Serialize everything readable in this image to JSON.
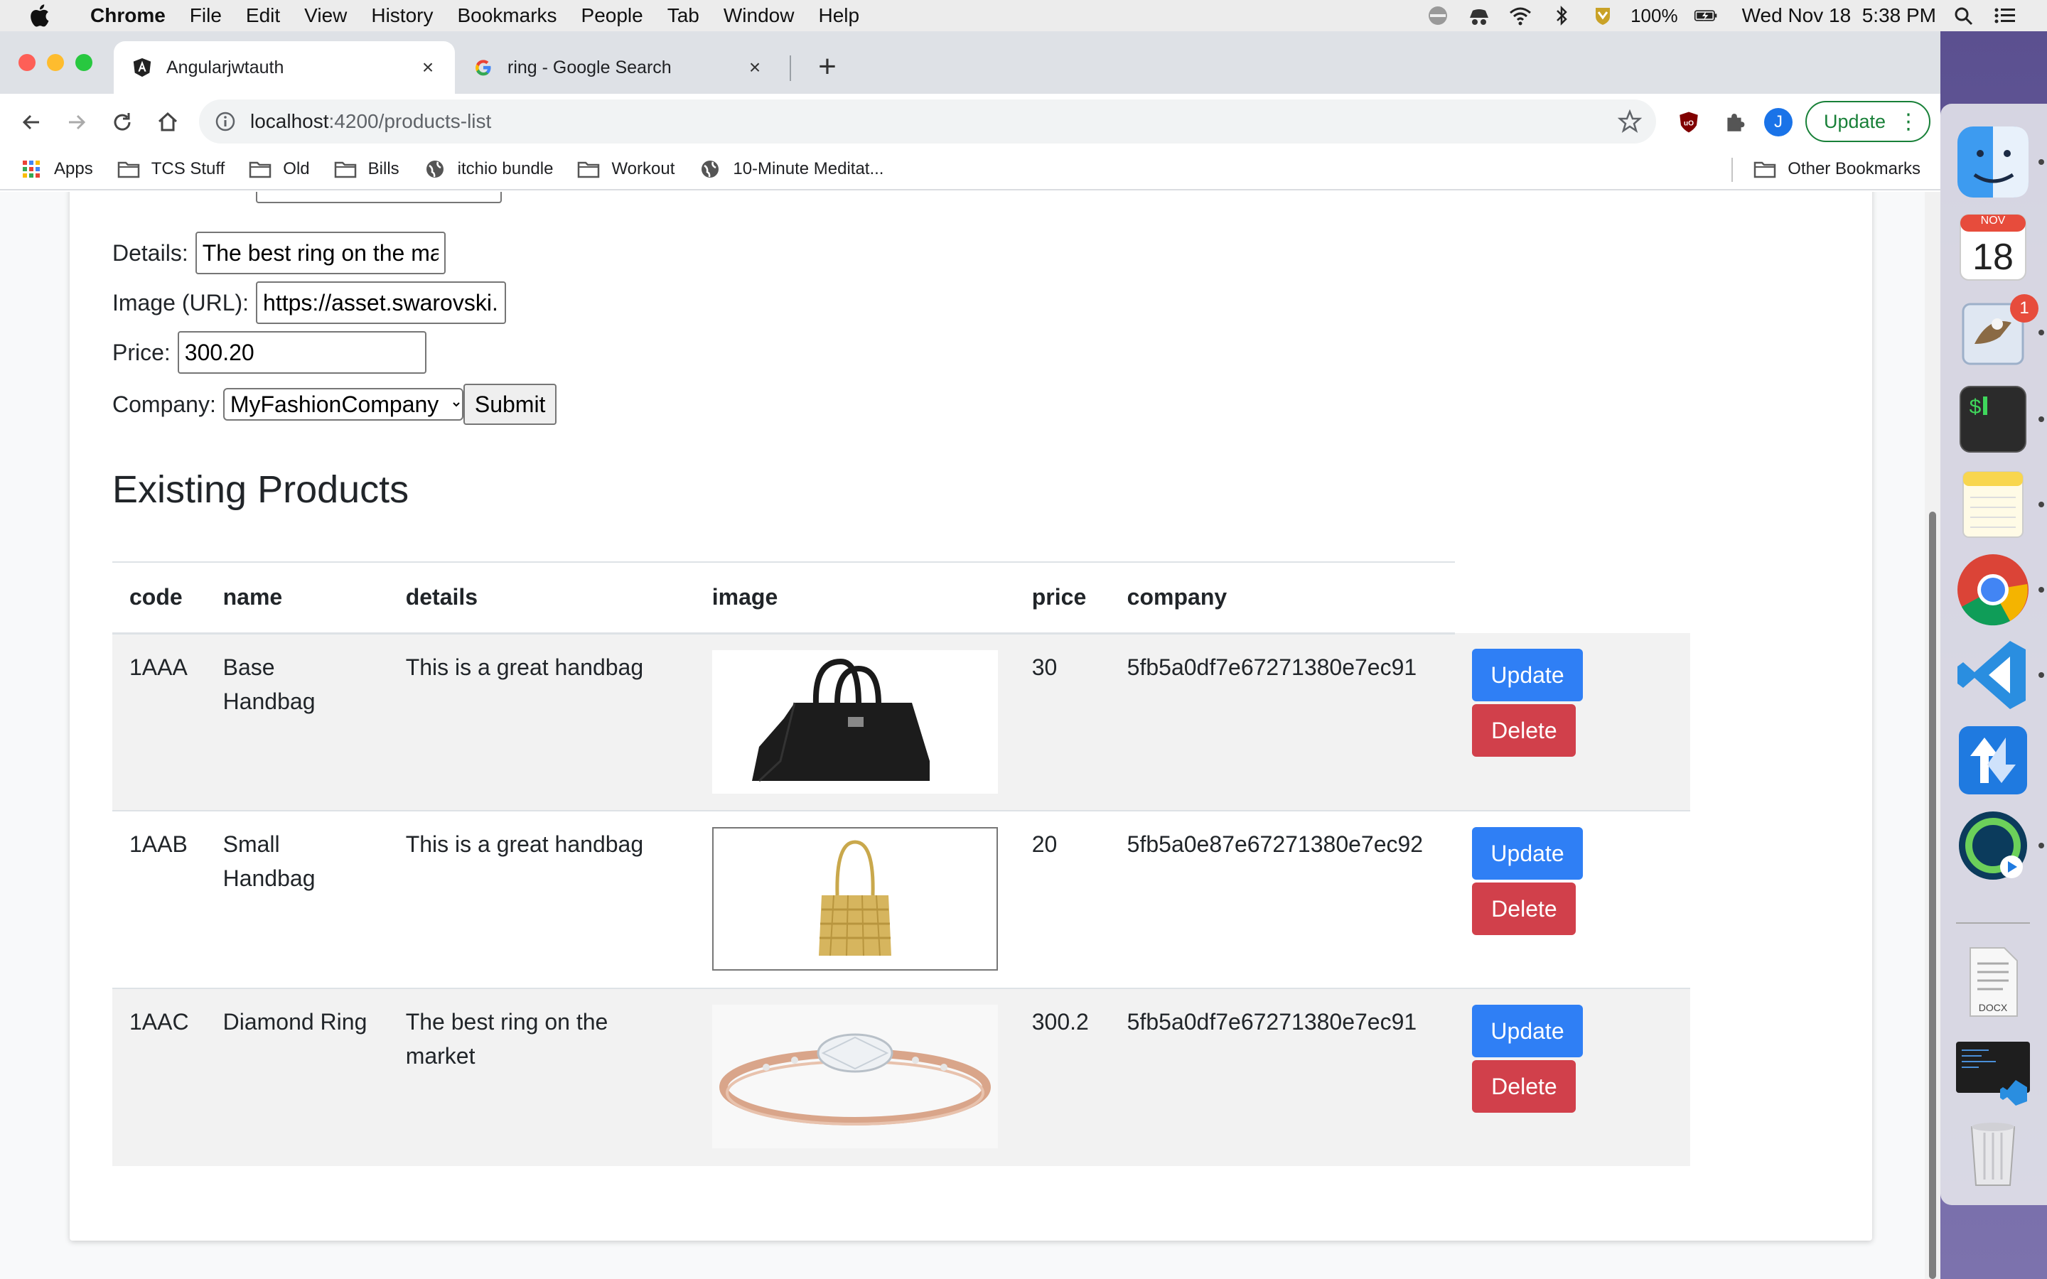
{
  "menubar": {
    "app_name": "Chrome",
    "items": [
      "File",
      "Edit",
      "View",
      "History",
      "Bookmarks",
      "People",
      "Tab",
      "Window",
      "Help"
    ],
    "battery": "100%",
    "datetime": "Wed Nov 18  5:38 PM"
  },
  "tabs": [
    {
      "title": "Angularjwtauth",
      "icon": "angular-icon",
      "active": true
    },
    {
      "title": "ring - Google Search",
      "icon": "google-icon",
      "active": false
    }
  ],
  "toolbar": {
    "url_host": "localhost",
    "url_path": ":4200/products-list",
    "profile_initial": "J",
    "update_label": "Update"
  },
  "bookmarks": {
    "items": [
      "Apps",
      "TCS Stuff",
      "Old",
      "Bills",
      "itchio bundle",
      "Workout",
      "10-Minute Meditat..."
    ],
    "other": "Other Bookmarks"
  },
  "form": {
    "details_label": "Details:",
    "details_value": "The best ring on the market",
    "image_label": "Image (URL):",
    "image_value": "https://asset.swarovski.com",
    "price_label": "Price:",
    "price_value": "300.20",
    "company_label": "Company:",
    "company_value": "MyFashionCompany",
    "submit_label": "Submit"
  },
  "products": {
    "heading": "Existing Products",
    "columns": [
      "code",
      "name",
      "details",
      "image",
      "price",
      "company"
    ],
    "rows": [
      {
        "code": "1AAA",
        "name": "Base Handbag",
        "details": "This is a great handbag",
        "image": "black-handbag",
        "price": "30",
        "company": "5fb5a0df7e67271380e7ec91"
      },
      {
        "code": "1AAB",
        "name": "Small Handbag",
        "details": "This is a great handbag",
        "image": "woven-gold-handbag",
        "price": "20",
        "company": "5fb5a0e87e67271380e7ec92"
      },
      {
        "code": "1AAC",
        "name": "Diamond Ring",
        "details": "The best ring on the market",
        "image": "diamond-ring",
        "price": "300.2",
        "company": "5fb5a0df7e67271380e7ec91"
      }
    ],
    "update_label": "Update",
    "delete_label": "Delete"
  },
  "dock": {
    "calendar_month": "NOV",
    "calendar_day": "18",
    "mail_badge": "1",
    "file_label": "DOCX"
  }
}
